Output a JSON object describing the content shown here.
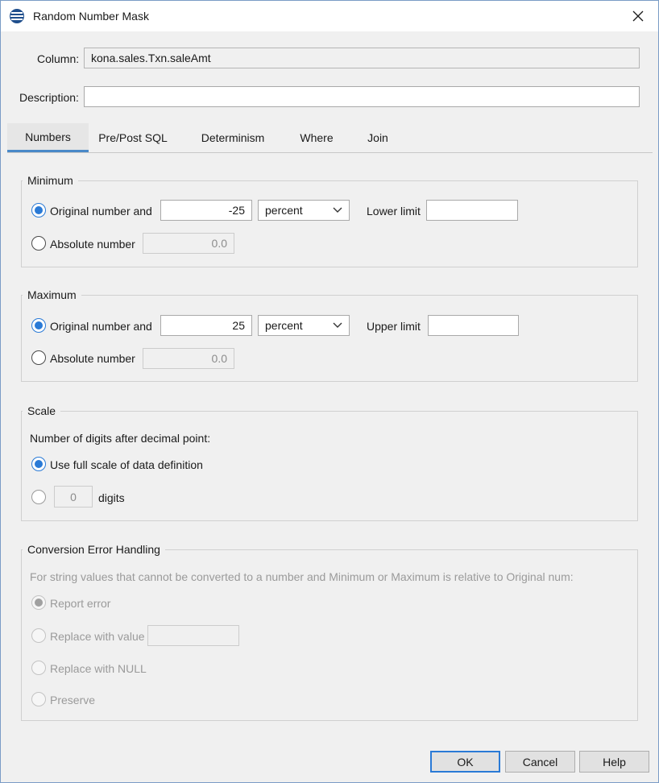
{
  "window": {
    "title": "Random Number Mask"
  },
  "column": {
    "label": "Column:",
    "value": "kona.sales.Txn.saleAmt"
  },
  "description": {
    "label": "Description:",
    "value": ""
  },
  "tabs": [
    {
      "label": "Numbers",
      "active": true
    },
    {
      "label": "Pre/Post SQL",
      "active": false
    },
    {
      "label": "Determinism",
      "active": false
    },
    {
      "label": "Where",
      "active": false
    },
    {
      "label": "Join",
      "active": false
    }
  ],
  "minimum": {
    "title": "Minimum",
    "original_label": "Original number and",
    "original_value": "-25",
    "unit": "percent",
    "limit_label": "Lower limit",
    "limit_value": "",
    "absolute_label": "Absolute number",
    "absolute_value": "0.0"
  },
  "maximum": {
    "title": "Maximum",
    "original_label": "Original number and",
    "original_value": "25",
    "unit": "percent",
    "limit_label": "Upper limit",
    "limit_value": "",
    "absolute_label": "Absolute number",
    "absolute_value": "0.0"
  },
  "scale": {
    "title": "Scale",
    "caption": "Number of digits after decimal point:",
    "full_scale_label": "Use full scale of data definition",
    "digits_value": "0",
    "digits_label": "digits"
  },
  "conversion": {
    "title": "Conversion Error Handling",
    "caption": "For string values that cannot be converted to a number and Minimum or Maximum is relative to Original num:",
    "report_label": "Report error",
    "replace_label": "Replace with value",
    "replace_value": "",
    "null_label": "Replace with NULL",
    "preserve_label": "Preserve"
  },
  "buttons": {
    "ok": "OK",
    "cancel": "Cancel",
    "help": "Help"
  },
  "colors": {
    "accent": "#2a7ad6",
    "tab_underline": "#4a89c8"
  }
}
